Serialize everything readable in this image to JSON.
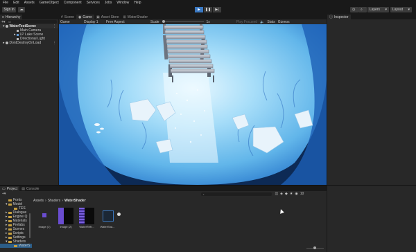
{
  "menu": [
    "File",
    "Edit",
    "Assets",
    "GameObject",
    "Component",
    "Services",
    "Jobs",
    "Window",
    "Help"
  ],
  "toolbar": {
    "sign_in": "Sign in",
    "layers": "Layers",
    "layout": "Layout"
  },
  "hierarchy": {
    "tab": "Hierarchy",
    "search_placeholder": "All",
    "scene": "WaterTestScene",
    "items": [
      "Main Camera",
      "LP Lake Scene",
      "Directional Light"
    ],
    "dontdestroy": "DontDestroyOnLoad"
  },
  "center_tabs": [
    "Scene",
    "Game",
    "Asset Store",
    "WaterShader"
  ],
  "game_bar": {
    "display": "Game",
    "display2": "Display 1",
    "aspect": "Free Aspect",
    "scale_label": "Scale",
    "scale_val": "1x",
    "play_mode": "Play Focused",
    "stats": "Stats",
    "gizmos": "Gizmos"
  },
  "inspector": {
    "tab": "Inspector"
  },
  "project": {
    "tabs": [
      "Project",
      "Console"
    ],
    "breadcrumb": [
      "Assets",
      "Shaders",
      "WaterShader"
    ],
    "tree": [
      {
        "label": "Fonts",
        "indent": 1
      },
      {
        "label": "Model",
        "indent": 1
      },
      {
        "label": "TES",
        "indent": 2
      },
      {
        "label": "Dialogue",
        "indent": 1
      },
      {
        "label": "Engine Q",
        "indent": 1
      },
      {
        "label": "Materials",
        "indent": 1
      },
      {
        "label": "Prefabs",
        "indent": 1
      },
      {
        "label": "Scenes",
        "indent": 1
      },
      {
        "label": "Scripts",
        "indent": 1
      },
      {
        "label": "Settings",
        "indent": 1
      },
      {
        "label": "Shaders",
        "indent": 1
      },
      {
        "label": "WaterS",
        "indent": 2
      }
    ],
    "assets": [
      {
        "label": "Image (1)",
        "kind": "small-purple"
      },
      {
        "label": "Image (2)",
        "kind": "black-purple"
      },
      {
        "label": "WaterRefr...",
        "kind": "black-stripe"
      },
      {
        "label": "WaterSha...",
        "kind": "shader"
      }
    ],
    "asset_count": "10"
  },
  "colors": {
    "accent": "#3a78c2",
    "water": "#8fd0f6"
  }
}
